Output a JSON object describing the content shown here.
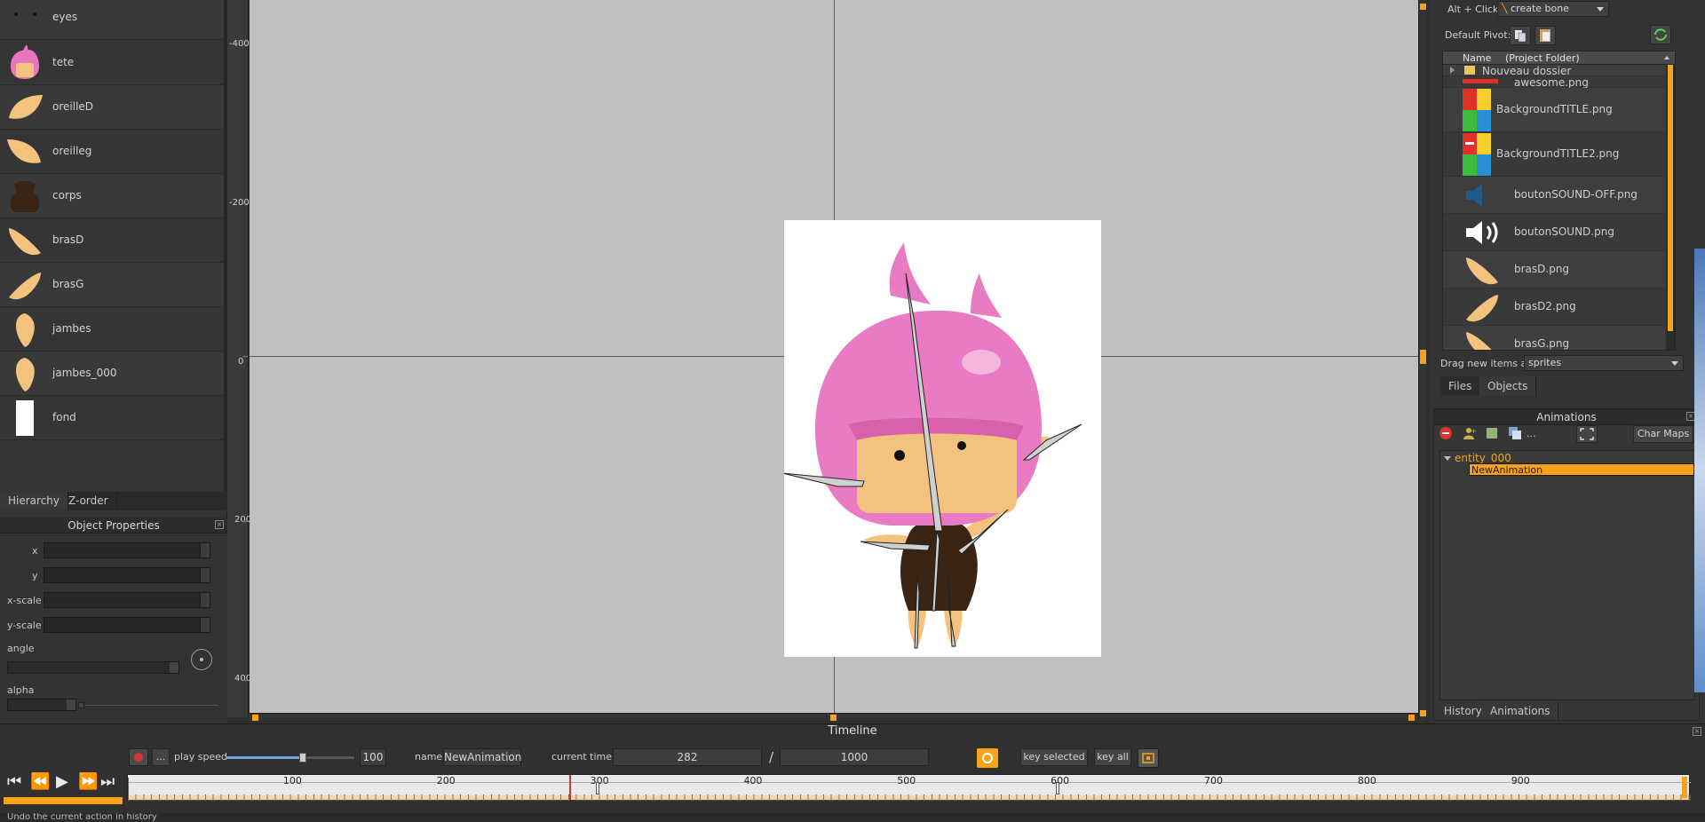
{
  "sprites": [
    {
      "label": "eyes"
    },
    {
      "label": "tete"
    },
    {
      "label": "oreilleD"
    },
    {
      "label": "oreilleg"
    },
    {
      "label": "corps"
    },
    {
      "label": "brasD"
    },
    {
      "label": "brasG"
    },
    {
      "label": "jambes"
    },
    {
      "label": "jambes_000"
    },
    {
      "label": "fond"
    }
  ],
  "left_tabs": {
    "hierarchy": "Hierarchy",
    "zorder": "Z-order"
  },
  "object_properties": {
    "title": "Object Properties",
    "x_label": "x",
    "y_label": "y",
    "xscale_label": "x-scale",
    "yscale_label": "y-scale",
    "angle_label": "angle",
    "alpha_label": "alpha"
  },
  "ruler_v": [
    "-400",
    "-200",
    "0",
    "200",
    "400"
  ],
  "right_top": {
    "altclick_label": "Alt + Click:",
    "altclick_value": "create bone",
    "pivot_label": "Default Pivot:"
  },
  "files": {
    "header_name": "Name",
    "header_folder": "(Project Folder)",
    "rows": [
      {
        "name": "Nouveau dossier"
      },
      {
        "name": "awesome.png"
      },
      {
        "name": "BackgroundTITLE.png"
      },
      {
        "name": "BackgroundTITLE2.png"
      },
      {
        "name": "boutonSOUND-OFF.png"
      },
      {
        "name": "boutonSOUND.png"
      },
      {
        "name": "brasD.png"
      },
      {
        "name": "brasD2.png"
      },
      {
        "name": "brasG.png"
      }
    ],
    "drag_label": "Drag new items as",
    "drag_value": "sprites",
    "tab_files": "Files",
    "tab_objects": "Objects"
  },
  "animations": {
    "title": "Animations",
    "charmaps_label": "Char Maps",
    "entity": "entity_000",
    "animation": "NewAnimation",
    "tab_history": "History",
    "tab_animations": "Animations"
  },
  "timeline": {
    "title": "Timeline",
    "play_speed_label": "play speed",
    "play_speed_value": "100",
    "play_speed_fraction": 0.6,
    "name_label": "name",
    "name_value": "NewAnimation",
    "current_time_label": "current time:",
    "current_time": "282",
    "separator": "/",
    "total_time": "1000",
    "key_selected": "key selected",
    "key_all": "key all",
    "ellipsis": "...",
    "ticks": [
      "100",
      "200",
      "300",
      "400",
      "500",
      "600",
      "700",
      "800",
      "900"
    ],
    "tick_values": [
      100,
      200,
      300,
      400,
      500,
      600,
      700,
      800,
      900
    ],
    "marker_value": 282,
    "key_values": [
      300,
      600
    ]
  },
  "status": "Undo the current action in history",
  "colors": {
    "accent": "#f7a21b",
    "canvas": "#c0c0c0",
    "selection": "#f7a21b",
    "entity_text": "#f7a21b"
  }
}
